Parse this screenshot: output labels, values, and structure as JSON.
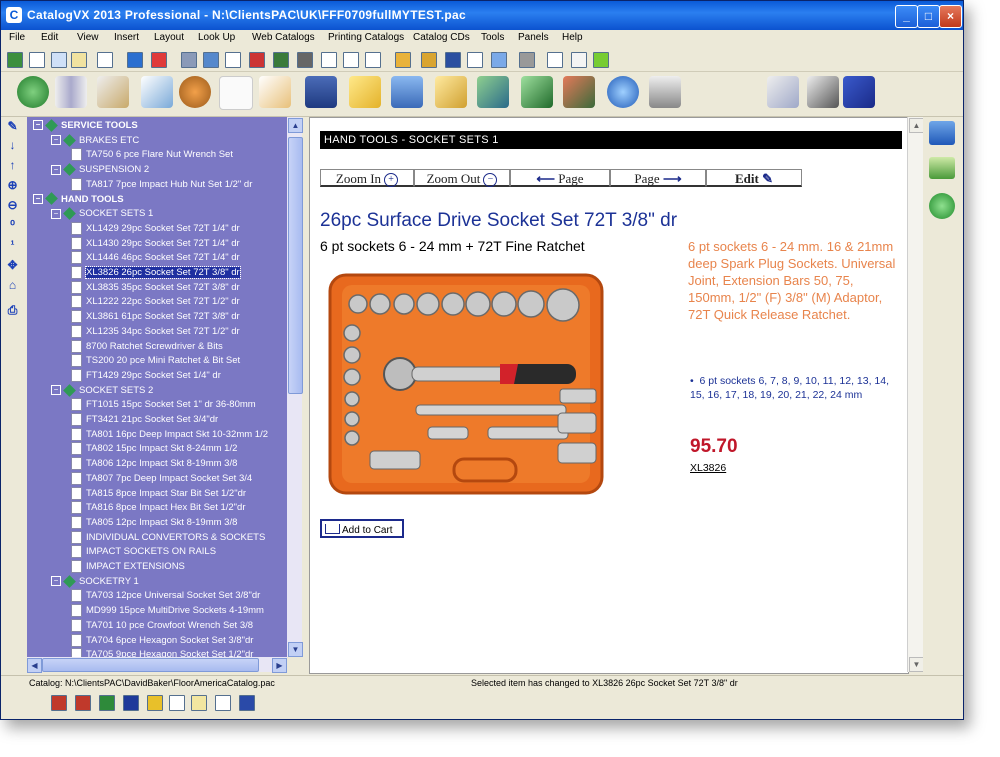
{
  "window": {
    "title": "CatalogVX 2013 Professional - N:\\ClientsPAC\\UK\\FFF0709fullMYTEST.pac",
    "app_icon": "catalogvx-icon",
    "controls": [
      "minimize",
      "maximize",
      "close"
    ]
  },
  "menu": [
    "File",
    "Edit",
    "View",
    "Insert",
    "Layout",
    "Look Up",
    "Web Catalogs",
    "Printing Catalogs",
    "Catalog CDs",
    "Tools",
    "Panels",
    "Help"
  ],
  "tree": {
    "nodes": [
      {
        "text": "SERVICE TOOLS",
        "level": 0,
        "kind": "group",
        "toggle": "−",
        "bold": true
      },
      {
        "text": "BRAKES ETC",
        "level": 1,
        "kind": "group",
        "toggle": "−"
      },
      {
        "text": "TA750 6 pce Flare Nut Wrench Set",
        "level": 2,
        "kind": "item"
      },
      {
        "text": "SUSPENSION 2",
        "level": 1,
        "kind": "group",
        "toggle": "−"
      },
      {
        "text": "TA817 7pce Impact Hub Nut Set 1/2\" dr",
        "level": 2,
        "kind": "item"
      },
      {
        "text": "HAND TOOLS",
        "level": 0,
        "kind": "group",
        "toggle": "−",
        "bold": true
      },
      {
        "text": "SOCKET SETS 1",
        "level": 1,
        "kind": "group",
        "toggle": "−"
      },
      {
        "text": "XL1429 29pc Socket Set 72T 1/4\" dr",
        "level": 2,
        "kind": "item"
      },
      {
        "text": "XL1430 29pc Socket Set 72T 1/4\" dr",
        "level": 2,
        "kind": "item"
      },
      {
        "text": "XL1446 46pc Socket Set 72T 1/4\" dr",
        "level": 2,
        "kind": "item"
      },
      {
        "text": "XL3826 26pc Socket Set 72T 3/8\" dr",
        "level": 2,
        "kind": "item",
        "selected": true
      },
      {
        "text": "XL3835 35pc Socket Set 72T 3/8\" dr",
        "level": 2,
        "kind": "item"
      },
      {
        "text": "XL1222 22pc Socket Set 72T 1/2\" dr",
        "level": 2,
        "kind": "item"
      },
      {
        "text": "XL3861 61pc Socket Set 72T 3/8\" dr",
        "level": 2,
        "kind": "item"
      },
      {
        "text": "XL1235 34pc Socket Set 72T 1/2\" dr",
        "level": 2,
        "kind": "item"
      },
      {
        "text": "8700 Ratchet Screwdriver & Bits",
        "level": 2,
        "kind": "item"
      },
      {
        "text": "TS200 20 pce Mini Ratchet & Bit Set",
        "level": 2,
        "kind": "item"
      },
      {
        "text": "FT1429 29pc Socket Set 1/4\" dr",
        "level": 2,
        "kind": "item"
      },
      {
        "text": "SOCKET SETS 2",
        "level": 1,
        "kind": "group",
        "toggle": "−"
      },
      {
        "text": "FT1015 15pc Socket Set 1\" dr 36-80mm",
        "level": 2,
        "kind": "item"
      },
      {
        "text": "FT3421 21pc Socket Set 3/4\"dr",
        "level": 2,
        "kind": "item"
      },
      {
        "text": "TA801 16pc Deep Impact Skt 10-32mm 1/2",
        "level": 2,
        "kind": "item"
      },
      {
        "text": "TA802 15pc Impact Skt 8-24mm 1/2",
        "level": 2,
        "kind": "item"
      },
      {
        "text": "TA806 12pc Impact Skt 8-19mm 3/8",
        "level": 2,
        "kind": "item"
      },
      {
        "text": "TA807 7pc Deep Impact Socket Set 3/4",
        "level": 2,
        "kind": "item"
      },
      {
        "text": "TA815 8pce Impact Star Bit Set 1/2\"dr",
        "level": 2,
        "kind": "item"
      },
      {
        "text": "TA816 8pce Impact Hex Bit Set 1/2\"dr",
        "level": 2,
        "kind": "item"
      },
      {
        "text": "TA805 12pc Impact Skt 8-19mm 3/8",
        "level": 2,
        "kind": "item"
      },
      {
        "text": "INDIVIDUAL CONVERTORS & SOCKETS",
        "level": 2,
        "kind": "item"
      },
      {
        "text": "IMPACT SOCKETS ON RAILS",
        "level": 2,
        "kind": "item"
      },
      {
        "text": "IMPACT EXTENSIONS",
        "level": 2,
        "kind": "item"
      },
      {
        "text": "SOCKETRY 1",
        "level": 1,
        "kind": "group",
        "toggle": "−"
      },
      {
        "text": "TA703 12pce Universal Socket Set 3/8\"dr",
        "level": 2,
        "kind": "item"
      },
      {
        "text": "MD999 15pce MultiDrive Sockets 4-19mm",
        "level": 2,
        "kind": "item"
      },
      {
        "text": "TA701 10 pce Crowfoot Wrench Set 3/8",
        "level": 2,
        "kind": "item"
      },
      {
        "text": "TA704 6pce Hexagon Socket Set 3/8\"dr",
        "level": 2,
        "kind": "item"
      },
      {
        "text": "TA705 9pce Hexagon Socket Set 1/2\"dr",
        "level": 2,
        "kind": "item"
      }
    ]
  },
  "page": {
    "header": "HAND TOOLS - SOCKET SETS 1",
    "nav": {
      "zoom_in": "Zoom In",
      "zoom_out": "Zoom Out",
      "page_prev": "Page",
      "page_next": "Page",
      "edit": "Edit"
    },
    "product": {
      "title": "26pc Surface Drive Socket Set 72T 3/8\" dr",
      "subtitle": "6 pt sockets 6 - 24 mm + 72T Fine Ratchet",
      "description": "6 pt sockets 6 - 24 mm. 16 & 21mm deep Spark Plug Sockets. Universal Joint, Extension Bars 50, 75, 150mm, 1/2\" (F) 3/8\" (M) Adaptor, 72T Quick Release Ratchet.",
      "feature": "6 pt sockets 6, 7, 8, 9, 10, 11, 12, 13, 14, 15, 16, 17, 18, 19, 20, 21, 22, 24 mm",
      "price": "95.70",
      "sku": "XL3826",
      "add_to_cart": "Add to Cart"
    }
  },
  "status": {
    "catalog": "Catalog: N:\\ClientsPAC\\DavidBaker\\FloorAmericaCatalog.pac",
    "message": "Selected item has changed to XL3826 26pc Socket Set 72T 3/8\" dr"
  },
  "colors": {
    "tree_bg": "#7b78c4",
    "title_blue": "#1c3296",
    "desc_orange": "#e8844c",
    "price_red": "#c0172a",
    "case_orange": "#e8691e"
  }
}
